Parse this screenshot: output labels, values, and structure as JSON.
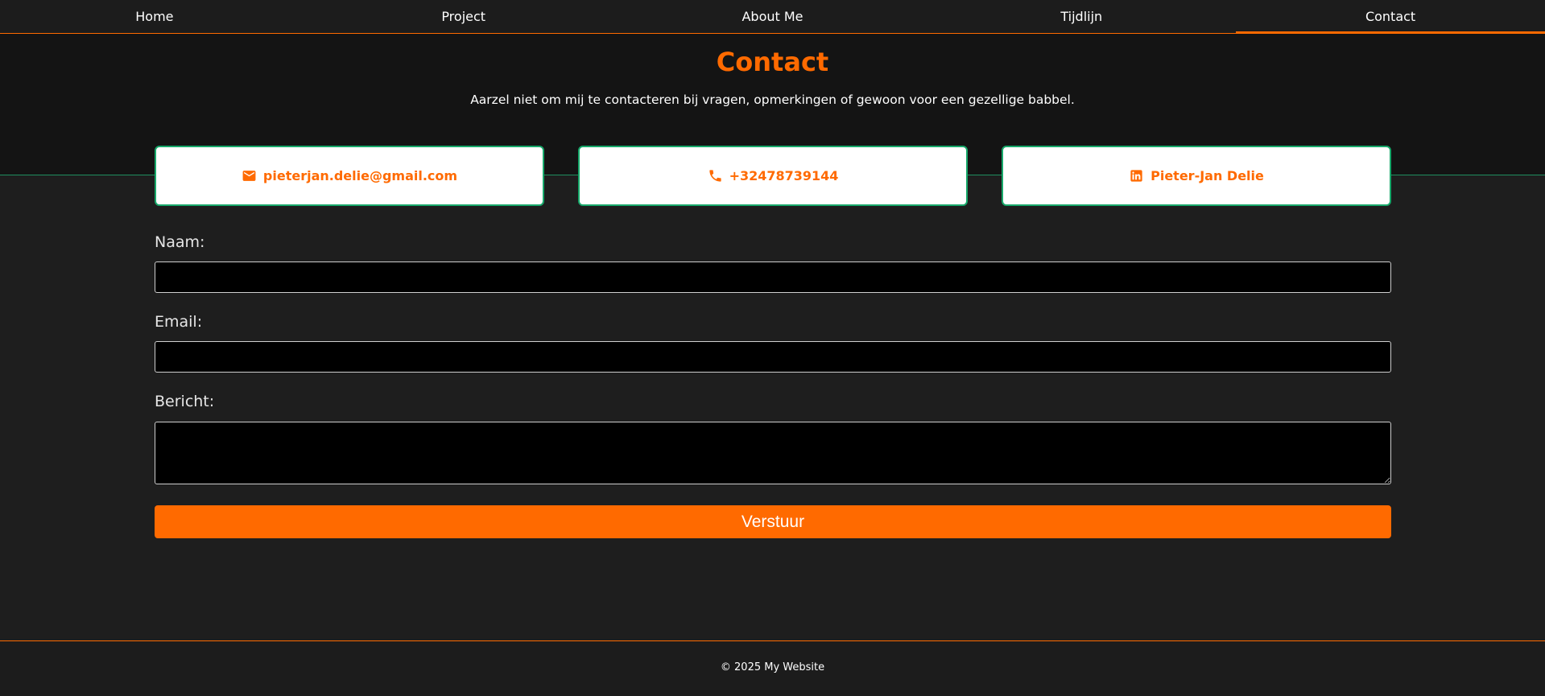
{
  "nav": {
    "items": [
      {
        "label": "Home"
      },
      {
        "label": "Project"
      },
      {
        "label": "About Me"
      },
      {
        "label": "Tijdlijn"
      },
      {
        "label": "Contact"
      }
    ],
    "active": "Contact"
  },
  "hero": {
    "title": "Contact",
    "subtitle": "Aarzel niet om mij te contacteren bij vragen, opmerkingen of gewoon voor een gezellige babbel."
  },
  "contact_cards": {
    "email": {
      "icon": "mail-icon",
      "label": "pieterjan.delie@gmail.com"
    },
    "phone": {
      "icon": "phone-icon",
      "label": "+32478739144"
    },
    "linkedin": {
      "icon": "linkedin-icon",
      "label": "Pieter-Jan Delie"
    }
  },
  "form": {
    "name_label": "Naam:",
    "name_value": "",
    "email_label": "Email:",
    "email_value": "",
    "message_label": "Bericht:",
    "message_value": "",
    "submit_label": "Verstuur"
  },
  "footer": {
    "text": "© 2025 My Website"
  },
  "colors": {
    "accent": "#ff6a00",
    "card_border": "#17a86a",
    "background": "#1e1e1e",
    "hero_background": "#141414"
  }
}
